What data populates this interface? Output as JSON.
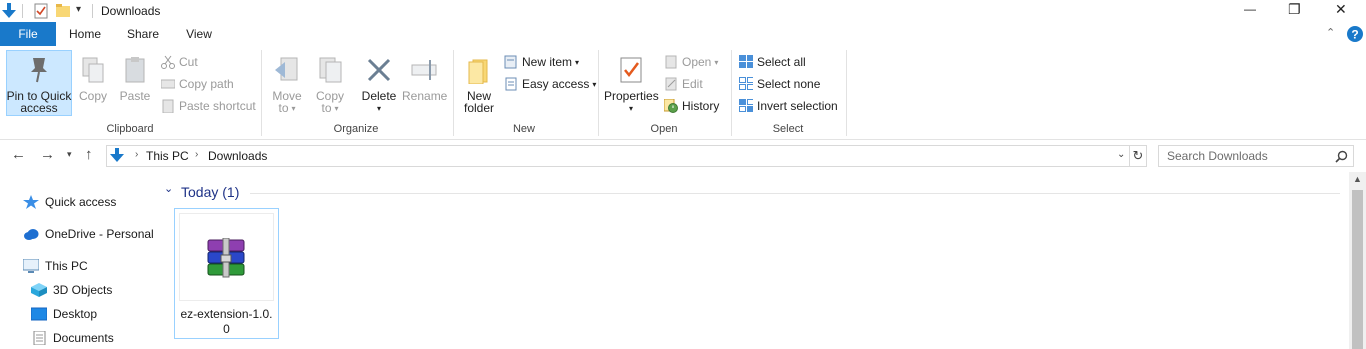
{
  "window": {
    "title": "Downloads",
    "controls": {
      "minimize": "—",
      "restore": "❐",
      "close": "✕"
    }
  },
  "ribbon_tabs": [
    "File",
    "Home",
    "Share",
    "View"
  ],
  "ribbon": {
    "clipboard": {
      "group_label": "Clipboard",
      "pin_line1": "Pin to Quick",
      "pin_line2": "access",
      "copy": "Copy",
      "paste": "Paste",
      "cut": "Cut",
      "copy_path": "Copy path",
      "paste_shortcut": "Paste shortcut"
    },
    "organize": {
      "group_label": "Organize",
      "move_line1": "Move",
      "move_line2": "to",
      "copy_line1": "Copy",
      "copy_line2": "to",
      "delete": "Delete",
      "rename": "Rename"
    },
    "new": {
      "group_label": "New",
      "folder_line1": "New",
      "folder_line2": "folder",
      "new_item": "New item",
      "easy_access": "Easy access"
    },
    "open": {
      "group_label": "Open",
      "properties": "Properties",
      "open": "Open",
      "edit": "Edit",
      "history": "History"
    },
    "select": {
      "group_label": "Select",
      "select_all": "Select all",
      "select_none": "Select none",
      "invert_selection": "Invert selection"
    }
  },
  "address": {
    "crumbs": [
      "This PC",
      "Downloads"
    ],
    "search_placeholder": "Search Downloads"
  },
  "sidebar": {
    "items": [
      "Quick access",
      "OneDrive - Personal",
      "This PC",
      "3D Objects",
      "Desktop",
      "Documents"
    ]
  },
  "content": {
    "group_header": "Today (1)",
    "files": [
      {
        "name_line1": "ez-extension-1.0.",
        "name_line2": "0",
        "icon": "winrar-archive-icon"
      }
    ]
  },
  "colors": {
    "accent": "#1979ca",
    "selection_bg": "#cce8ff",
    "group_header": "#1e3287",
    "help": "#1979ca"
  }
}
